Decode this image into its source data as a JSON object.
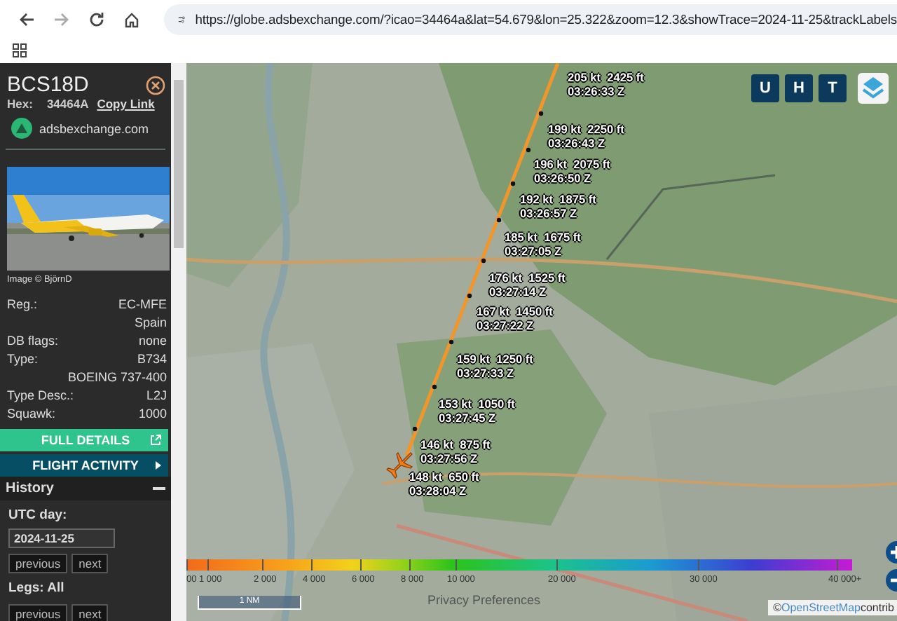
{
  "browser": {
    "url": "https://globe.adsbexchange.com/?icao=34464a&lat=54.679&lon=25.322&zoom=12.3&showTrace=2024-11-25&trackLabels",
    "forward_disabled": true
  },
  "sidebar": {
    "callsign": "BCS18D",
    "hex_label": "Hex:",
    "hex": "34464A",
    "copy_link": "Copy Link",
    "source": "adsbexchange.com",
    "image_credit": "Image © BjörnD",
    "fields": [
      {
        "label": "Reg.:",
        "value": "EC-MFE"
      },
      {
        "value": "Spain"
      },
      {
        "label": "DB flags:",
        "value": "none"
      },
      {
        "label": "Type:",
        "value": "B734"
      },
      {
        "value": "BOEING 737-400"
      },
      {
        "label": "Type Desc.:",
        "value": "L2J"
      },
      {
        "label": "Squawk:",
        "value": "1000"
      }
    ],
    "full_details": "FULL DETAILS",
    "flight_activity": "FLIGHT ACTIVITY",
    "history": {
      "title": "History",
      "expanded": true,
      "utc_day_label": "UTC day:",
      "date": "2024-11-25",
      "previous": "previous",
      "next": "next",
      "legs_label": "Legs: All",
      "legs_previous": "previous",
      "legs_next": "next"
    }
  },
  "map": {
    "buttons": [
      "U",
      "H",
      "T"
    ],
    "track_labels": [
      {
        "speed": "205 kt",
        "altitude": "2425 ft",
        "time": "03:26:33 Z"
      },
      {
        "speed": "199 kt",
        "altitude": "2250 ft",
        "time": "03:26:43 Z"
      },
      {
        "speed": "196 kt",
        "altitude": "2075 ft",
        "time": "03:26:50 Z"
      },
      {
        "speed": "192 kt",
        "altitude": "1875 ft",
        "time": "03:26:57 Z"
      },
      {
        "speed": "185 kt",
        "altitude": "1675 ft",
        "time": "03:27:05 Z"
      },
      {
        "speed": "176 kt",
        "altitude": "1525 ft",
        "time": "03:27:14 Z"
      },
      {
        "speed": "167 kt",
        "altitude": "1450 ft",
        "time": "03:27:22 Z"
      },
      {
        "speed": "159 kt",
        "altitude": "1250 ft",
        "time": "03:27:33 Z"
      },
      {
        "speed": "153 kt",
        "altitude": "1050 ft",
        "time": "03:27:45 Z"
      },
      {
        "speed": "146 kt",
        "altitude": "875 ft",
        "time": "03:27:56 Z"
      },
      {
        "speed": "148 kt",
        "altitude": "650 ft",
        "time": "03:28:04 Z"
      }
    ],
    "legend_ticks": [
      "00",
      "1 000",
      "2 000",
      "4 000",
      "6 000",
      "8 000",
      "10 000",
      "20 000",
      "30 000",
      "40 000+"
    ],
    "scale": "1 NM",
    "privacy": "Privacy Preferences",
    "attribution_symbol": "©",
    "attribution_link": "OpenStreetMap",
    "attribution_text": "contrib"
  }
}
